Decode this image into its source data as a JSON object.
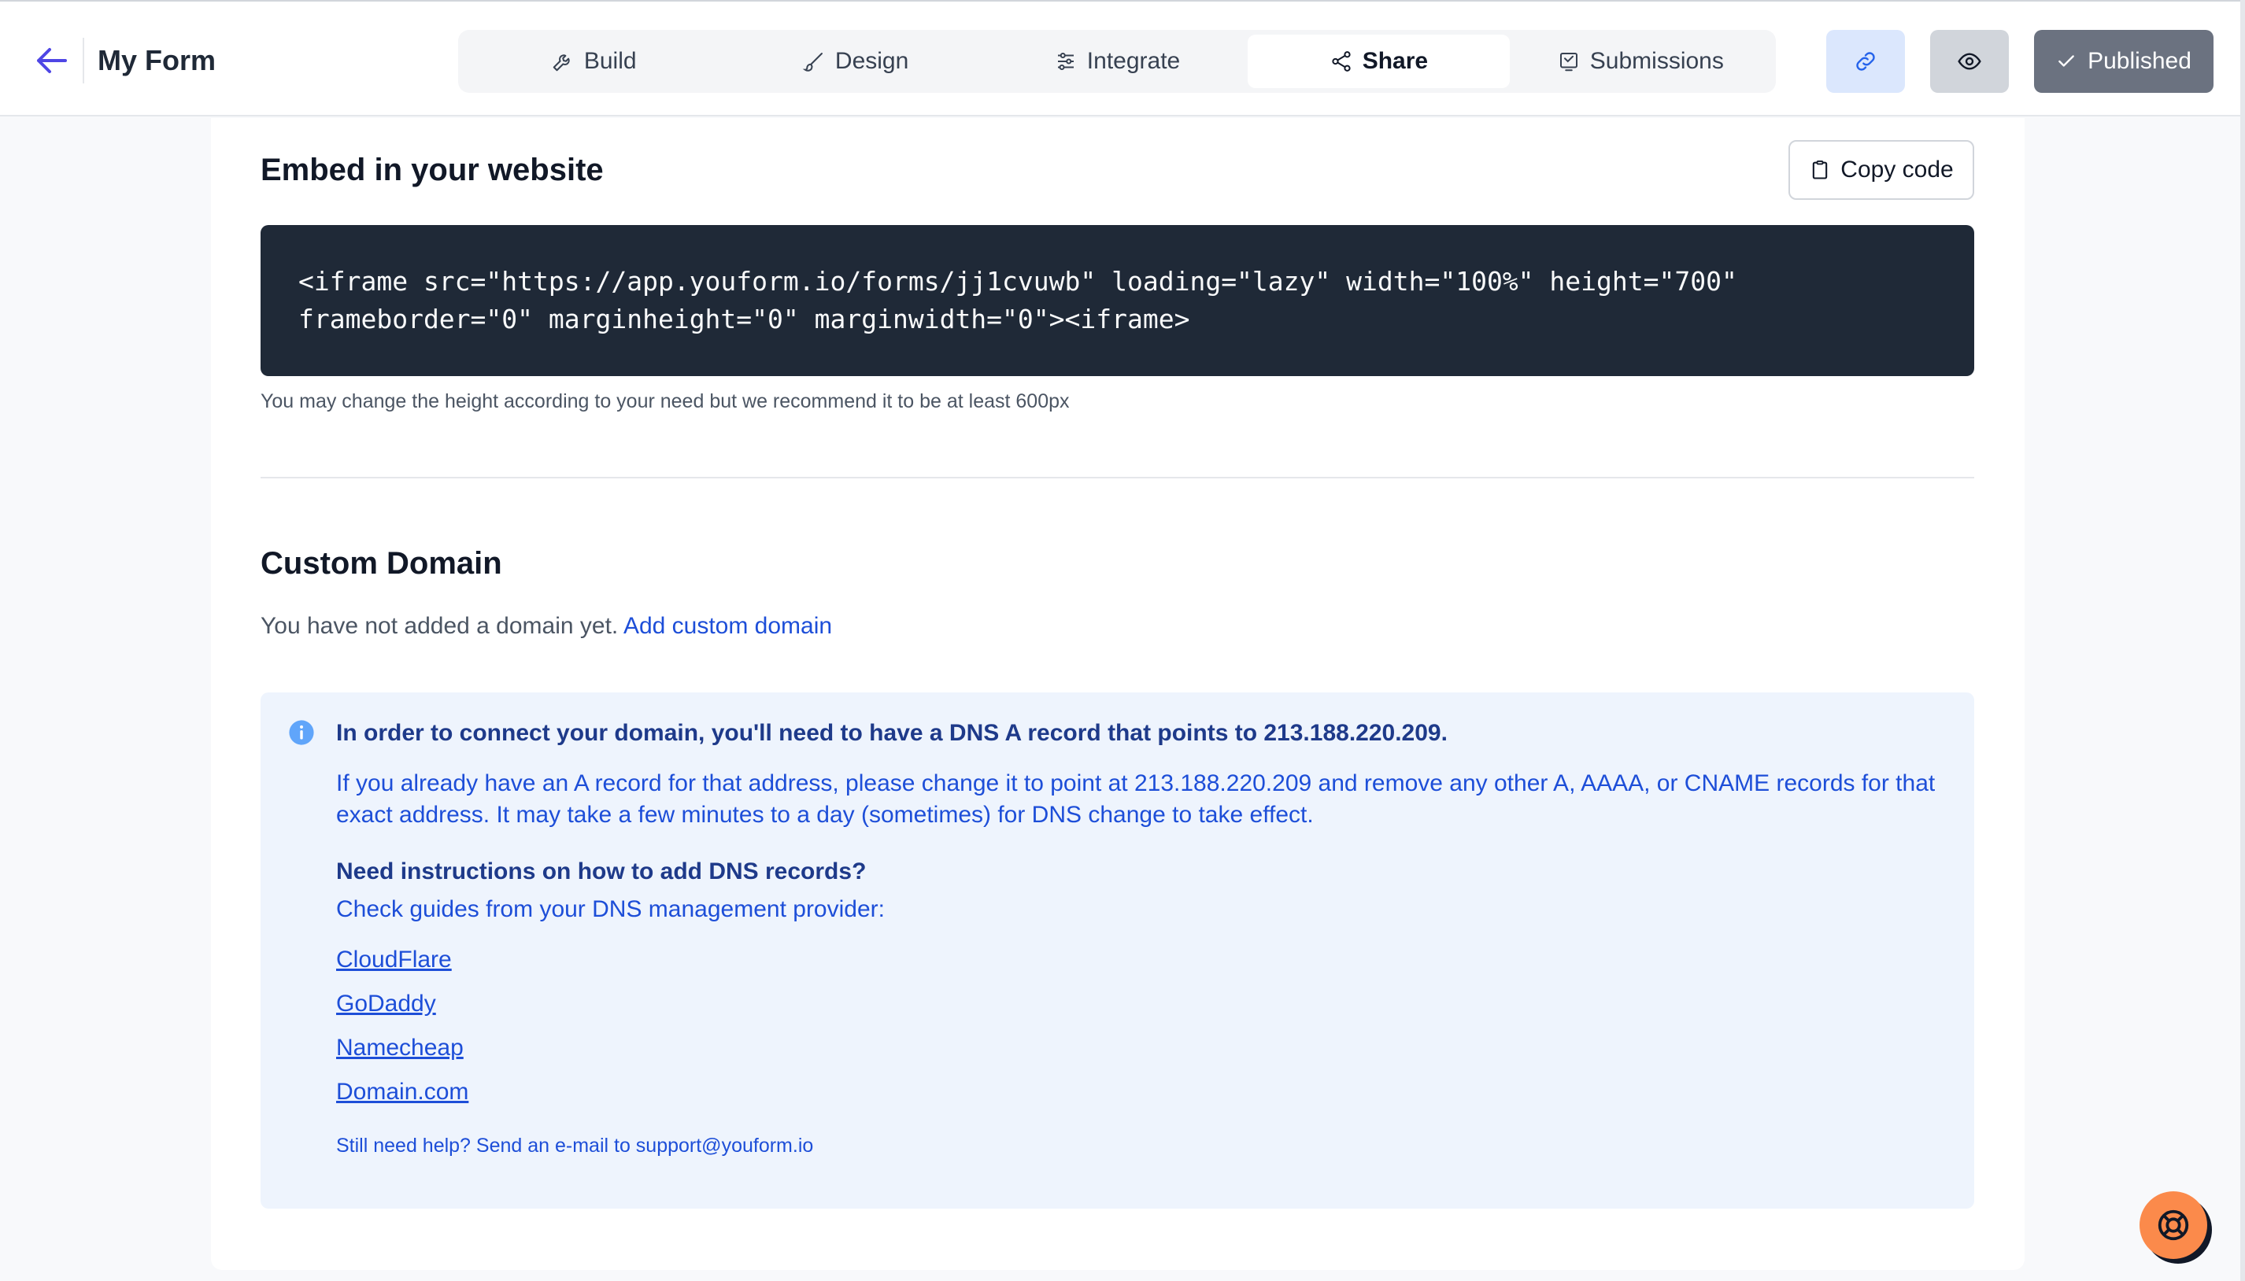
{
  "header": {
    "form_title": "My Form",
    "tabs": [
      {
        "label": "Build",
        "icon": "wrench-icon"
      },
      {
        "label": "Design",
        "icon": "brush-icon"
      },
      {
        "label": "Integrate",
        "icon": "sliders-icon"
      },
      {
        "label": "Share",
        "icon": "share-icon",
        "active": true
      },
      {
        "label": "Submissions",
        "icon": "inbox-icon"
      }
    ],
    "published_label": "Published"
  },
  "embed": {
    "heading": "Embed in your website",
    "copy_label": "Copy code",
    "code_line1": "<iframe src=\"https://app.youform.io/forms/jj1cvuwb\" loading=\"lazy\" width=\"100%\" height=\"700\"",
    "code_line2": "frameborder=\"0\" marginheight=\"0\" marginwidth=\"0\"><iframe>",
    "hint": "You may change the height according to your need but we recommend it to be at least 600px"
  },
  "custom_domain": {
    "heading": "Custom Domain",
    "empty_text": "You have not added a domain yet.",
    "add_link": "Add custom domain",
    "info": {
      "line1_prefix": "In order to connect your domain, you'll need to have a DNS A record that points to",
      "ip": "213.188.220.209",
      "line1_suffix": ".",
      "para_line1": "If you already have an A record for that address, please change it to point at 213.188.220.209 and remove any other A, AAAA, or CNAME records for that",
      "para_line2": "exact address. It may take a few minutes to a day (sometimes) for DNS change to take effect.",
      "instructions_heading": "Need instructions on how to add DNS records?",
      "instructions_sub": "Check guides from your DNS management provider:",
      "providers": [
        "CloudFlare",
        "GoDaddy",
        "Namecheap",
        "Domain.com"
      ],
      "support": "Still need help? Send an e-mail to support@youform.io"
    }
  },
  "colors": {
    "accent_blue": "#1d4ed8",
    "code_bg": "#1f2937",
    "info_bg": "#eef4fd",
    "published_bg": "#6b7280",
    "help_fab": "#fb8a4b"
  }
}
